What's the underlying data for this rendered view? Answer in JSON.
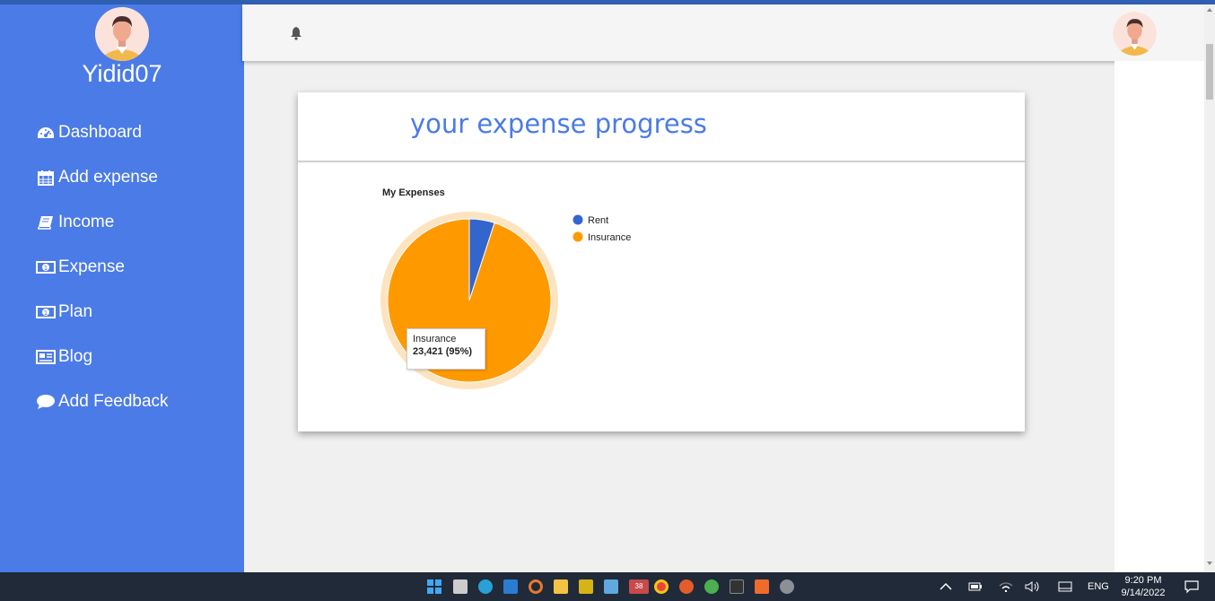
{
  "app": {
    "username": "Yidid07"
  },
  "sidebar": {
    "items": [
      {
        "label": "Dashboard",
        "icon": "dashboard-icon"
      },
      {
        "label": "Add expense",
        "icon": "calendar-icon"
      },
      {
        "label": "Income",
        "icon": "book-icon"
      },
      {
        "label": "Expense",
        "icon": "money-icon"
      },
      {
        "label": "Plan",
        "icon": "money-icon"
      },
      {
        "label": "Blog",
        "icon": "newspaper-icon"
      },
      {
        "label": "Add Feedback",
        "icon": "comment-icon"
      }
    ]
  },
  "header": {
    "bell_icon": "bell-icon",
    "avatar_icon": "user-avatar-icon"
  },
  "card": {
    "title": "your expense progress"
  },
  "chart_data": {
    "type": "pie",
    "title": "My Expenses",
    "slices": [
      {
        "name": "Rent",
        "percent": 5,
        "color": "#3366cc"
      },
      {
        "name": "Insurance",
        "value": 23421,
        "percent": 95,
        "color": "#ff9900"
      }
    ],
    "legend_placement": "right",
    "tooltip": {
      "label": "Insurance",
      "value": "23,421 (95%)"
    }
  },
  "colors": {
    "sidebar": "#4b7be6",
    "accent": "#4b7be6",
    "rent": "#3366cc",
    "insurance": "#ff9900"
  },
  "taskbar": {
    "time": "9:20 PM",
    "date": "9/14/2022",
    "language": "ENG",
    "badge_count": "38"
  }
}
